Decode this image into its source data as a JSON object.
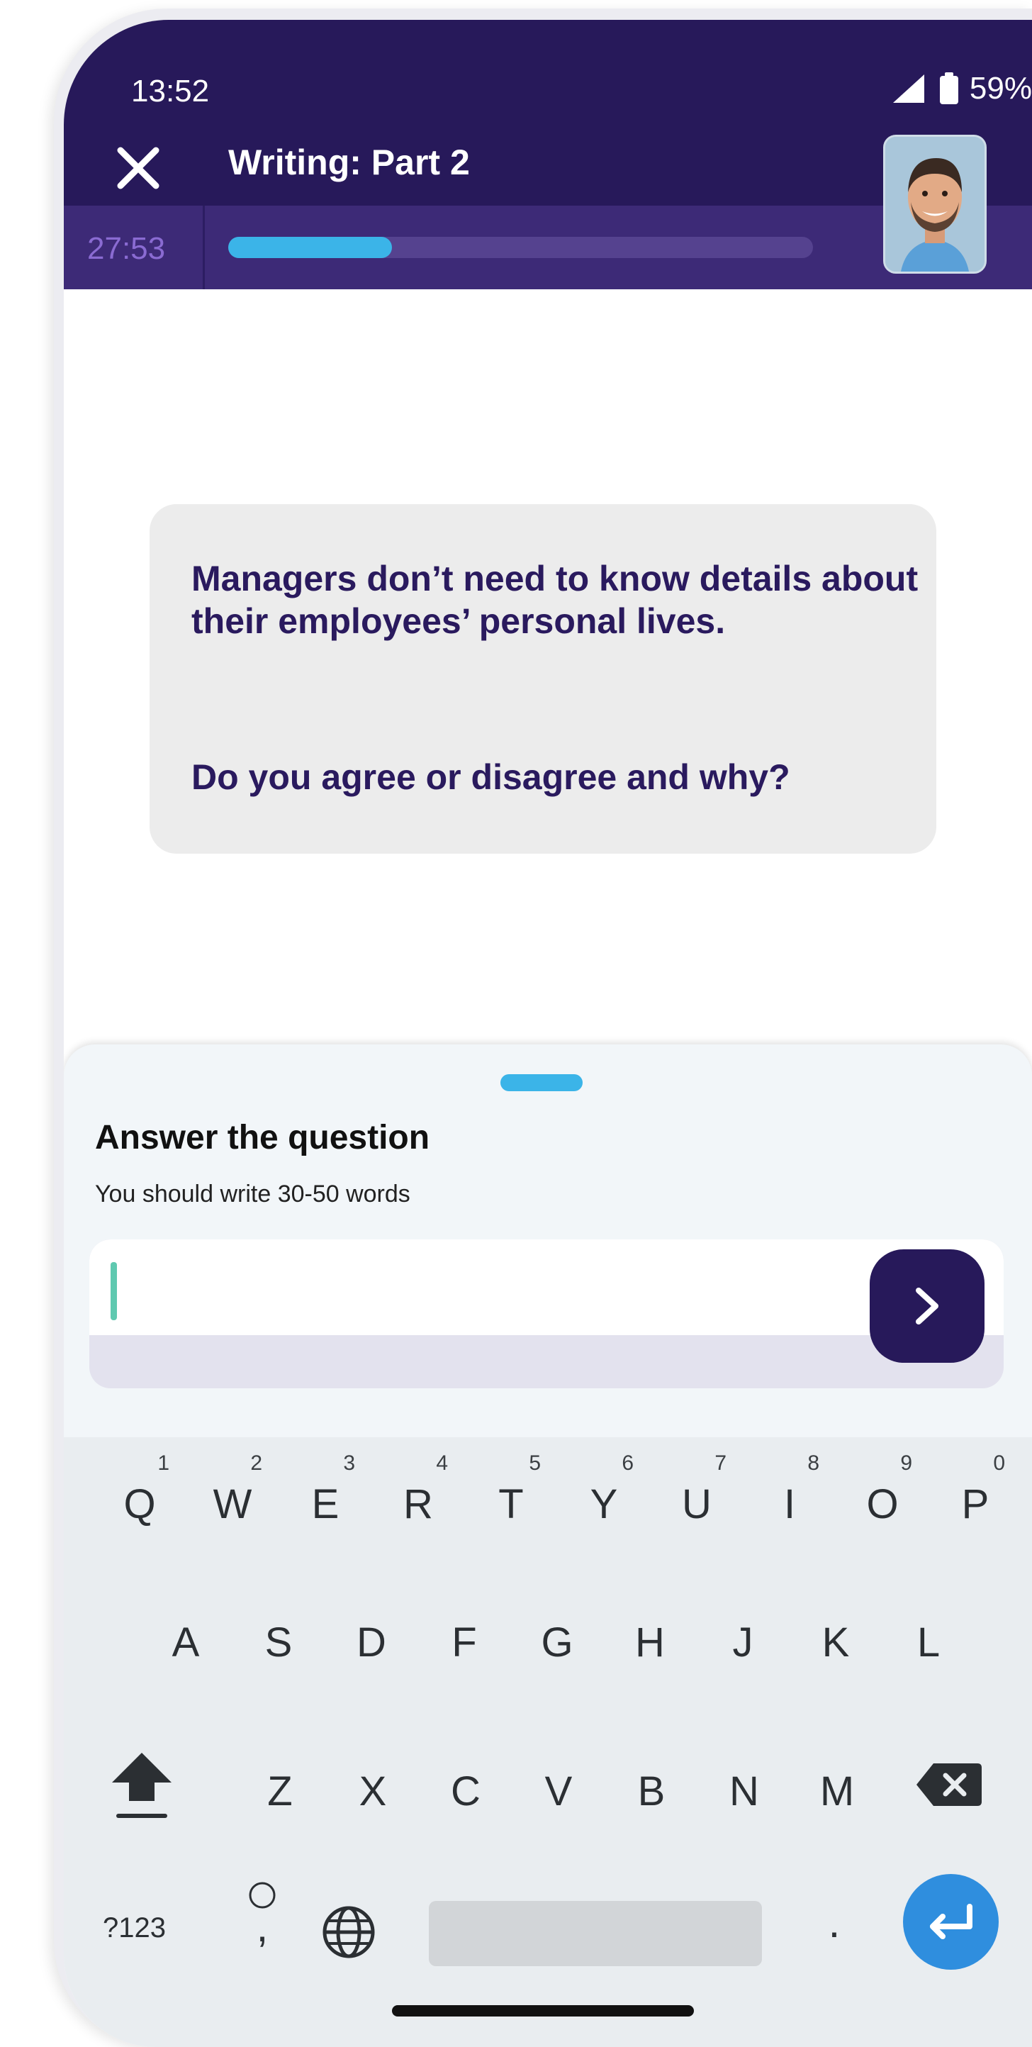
{
  "status_bar": {
    "time": "13:52",
    "battery": "59%",
    "signal_icon": "signal-icon",
    "battery_icon": "battery-icon"
  },
  "header": {
    "close_icon": "close-icon",
    "title": "Writing: Part 2",
    "timer": "27:53",
    "progress_fraction": 0.28,
    "progress_color": "#3bb4e8",
    "background": "#27195a",
    "avatar": "avatar-photo"
  },
  "prompt": {
    "statement": "Managers don’t need to know details about their employees’ personal lives.",
    "question": "Do you agree or disagree and why?"
  },
  "answer_sheet": {
    "title": "Answer the question",
    "subtitle": "You should write 30-50 words",
    "input_value": "",
    "submit_icon": "chevron-right-icon"
  },
  "keyboard": {
    "row1": [
      {
        "label": "Q",
        "hint": "1"
      },
      {
        "label": "W",
        "hint": "2"
      },
      {
        "label": "E",
        "hint": "3"
      },
      {
        "label": "R",
        "hint": "4"
      },
      {
        "label": "T",
        "hint": "5"
      },
      {
        "label": "Y",
        "hint": "6"
      },
      {
        "label": "U",
        "hint": "7"
      },
      {
        "label": "I",
        "hint": "8"
      },
      {
        "label": "O",
        "hint": "9"
      },
      {
        "label": "P",
        "hint": "0"
      }
    ],
    "row2": [
      "A",
      "S",
      "D",
      "F",
      "G",
      "H",
      "J",
      "K",
      "L"
    ],
    "row3": [
      "Z",
      "X",
      "C",
      "V",
      "B",
      "N",
      "M"
    ],
    "symbols_label": "?123",
    "comma_label": ",",
    "period_label": ".",
    "shift_icon": "shift-icon",
    "backspace_icon": "backspace-icon",
    "globe_icon": "globe-icon",
    "enter_icon": "enter-icon",
    "accent_color": "#2f8ede"
  }
}
